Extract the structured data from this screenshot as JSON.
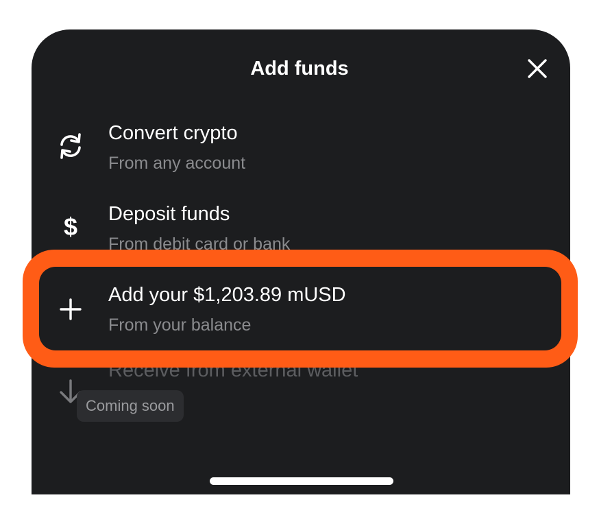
{
  "sheet": {
    "title": "Add funds",
    "close_icon": "close-icon"
  },
  "options": [
    {
      "title": "Convert crypto",
      "subtitle": "From any account",
      "icon": "refresh-icon"
    },
    {
      "title": "Deposit funds",
      "subtitle": "From debit card or bank",
      "icon": "dollar-icon",
      "glyph": "$"
    },
    {
      "title": "Add your $1,203.89 mUSD",
      "subtitle": "From your balance",
      "icon": "plus-icon",
      "highlighted": true
    },
    {
      "title": "Receive from external wallet",
      "badge": "Coming soon",
      "icon": "arrow-down-icon",
      "disabled": true
    }
  ],
  "colors": {
    "sheet_background": "#1c1d1f",
    "highlight": "#ff5c16",
    "text_primary": "#ffffff",
    "text_secondary": "#8a8b8e"
  }
}
